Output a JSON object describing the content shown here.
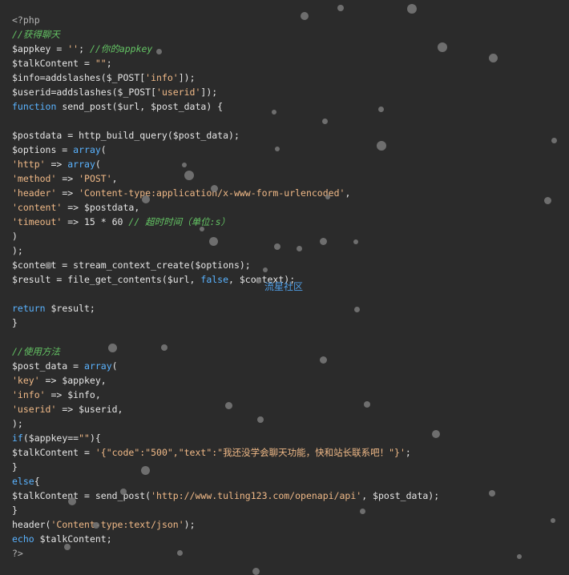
{
  "watermark": "流星社区",
  "lines": [
    [
      {
        "t": "<?php",
        "c": "gray"
      }
    ],
    [
      {
        "t": "//获得聊天",
        "c": "cm"
      }
    ],
    [
      {
        "t": "$appkey = ",
        "c": ""
      },
      {
        "t": "''",
        "c": "str"
      },
      {
        "t": "; ",
        "c": ""
      },
      {
        "t": "//你的appkey",
        "c": "cm"
      }
    ],
    [
      {
        "t": "$talkContent = ",
        "c": ""
      },
      {
        "t": "\"\"",
        "c": "str"
      },
      {
        "t": ";",
        "c": ""
      }
    ],
    [
      {
        "t": "$info=addslashes($_POST[",
        "c": ""
      },
      {
        "t": "'info'",
        "c": "str"
      },
      {
        "t": "]);",
        "c": ""
      }
    ],
    [
      {
        "t": "$userid=addslashes($_POST[",
        "c": ""
      },
      {
        "t": "'userid'",
        "c": "str"
      },
      {
        "t": "]);",
        "c": ""
      }
    ],
    [
      {
        "t": "function",
        "c": "kw"
      },
      {
        "t": " send_post($url, $post_data) {",
        "c": ""
      }
    ],
    [],
    [
      {
        "t": "$postdata = http_build_query($post_data);",
        "c": ""
      }
    ],
    [
      {
        "t": "$options = ",
        "c": ""
      },
      {
        "t": "array",
        "c": "kw"
      },
      {
        "t": "(",
        "c": ""
      }
    ],
    [
      {
        "t": "'http'",
        "c": "str"
      },
      {
        "t": " => ",
        "c": ""
      },
      {
        "t": "array",
        "c": "kw"
      },
      {
        "t": "(",
        "c": ""
      }
    ],
    [
      {
        "t": "'method'",
        "c": "str"
      },
      {
        "t": " => ",
        "c": ""
      },
      {
        "t": "'POST'",
        "c": "str"
      },
      {
        "t": ",",
        "c": ""
      }
    ],
    [
      {
        "t": "'header'",
        "c": "str"
      },
      {
        "t": " => ",
        "c": ""
      },
      {
        "t": "'Content-type:application/x-www-form-urlencoded'",
        "c": "str"
      },
      {
        "t": ",",
        "c": ""
      }
    ],
    [
      {
        "t": "'content'",
        "c": "str"
      },
      {
        "t": " => $postdata,",
        "c": ""
      }
    ],
    [
      {
        "t": "'timeout'",
        "c": "str"
      },
      {
        "t": " => 15 * 60 ",
        "c": ""
      },
      {
        "t": "// 超时时间（单位:s）",
        "c": "cm"
      }
    ],
    [
      {
        "t": ")",
        "c": ""
      }
    ],
    [
      {
        "t": ");",
        "c": ""
      }
    ],
    [
      {
        "t": "$context = stream_context_create($options);",
        "c": ""
      }
    ],
    [
      {
        "t": "$result = file_get_contents($url, ",
        "c": ""
      },
      {
        "t": "false",
        "c": "bool"
      },
      {
        "t": ", $context);",
        "c": ""
      }
    ],
    [],
    [
      {
        "t": "return",
        "c": "kw"
      },
      {
        "t": " $result;",
        "c": ""
      }
    ],
    [
      {
        "t": "}",
        "c": ""
      }
    ],
    [],
    [
      {
        "t": "//使用方法",
        "c": "cm"
      }
    ],
    [
      {
        "t": "$post_data = ",
        "c": ""
      },
      {
        "t": "array",
        "c": "kw"
      },
      {
        "t": "(",
        "c": ""
      }
    ],
    [
      {
        "t": "'key'",
        "c": "str"
      },
      {
        "t": " => $appkey,",
        "c": ""
      }
    ],
    [
      {
        "t": "'info'",
        "c": "str"
      },
      {
        "t": " => $info,",
        "c": ""
      }
    ],
    [
      {
        "t": "'userid'",
        "c": "str"
      },
      {
        "t": " => $userid,",
        "c": ""
      }
    ],
    [
      {
        "t": ");",
        "c": ""
      }
    ],
    [
      {
        "t": "if",
        "c": "kw"
      },
      {
        "t": "($appkey==",
        "c": ""
      },
      {
        "t": "\"\"",
        "c": "str"
      },
      {
        "t": "){",
        "c": ""
      }
    ],
    [
      {
        "t": "$talkContent = ",
        "c": ""
      },
      {
        "t": "'{\"code\":\"500\",\"text\":\"我还没学会聊天功能，快和站长联系吧！\"}'",
        "c": "str"
      },
      {
        "t": ";",
        "c": ""
      }
    ],
    [
      {
        "t": "}",
        "c": ""
      }
    ],
    [
      {
        "t": "else",
        "c": "kw"
      },
      {
        "t": "{",
        "c": ""
      }
    ],
    [
      {
        "t": "$talkContent = send_post(",
        "c": ""
      },
      {
        "t": "'http://www.tuling123.com/openapi/api'",
        "c": "str"
      },
      {
        "t": ", $post_data);",
        "c": ""
      }
    ],
    [
      {
        "t": "}",
        "c": ""
      }
    ],
    [
      {
        "t": "header(",
        "c": ""
      },
      {
        "t": "'Content-type:text/json'",
        "c": "str"
      },
      {
        "t": ");",
        "c": ""
      }
    ],
    [
      {
        "t": "echo",
        "c": "kw"
      },
      {
        "t": " $talkContent;",
        "c": ""
      }
    ],
    [
      {
        "t": "?>",
        "c": "gray"
      }
    ]
  ]
}
